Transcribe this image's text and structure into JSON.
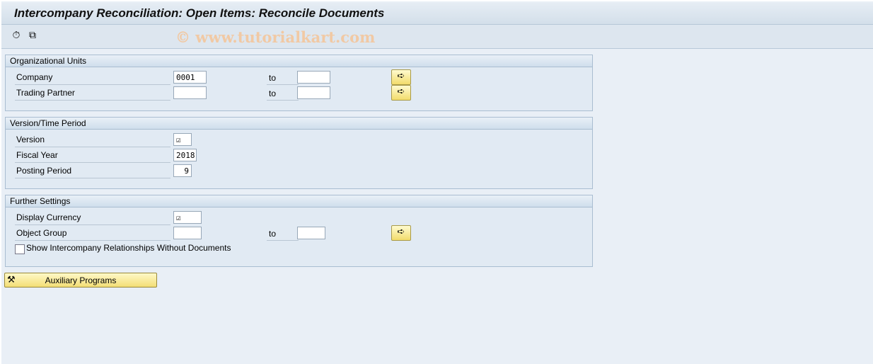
{
  "title": "Intercompany Reconciliation: Open Items: Reconcile Documents",
  "toolbar": {
    "icons": [
      "execute-background-icon",
      "get-variant-icon"
    ],
    "watermark": "© www.tutorialkart.com"
  },
  "org_units": {
    "header": "Organizational Units",
    "company": {
      "label": "Company",
      "from": "0001",
      "to_label": "to",
      "to": ""
    },
    "trading_partner": {
      "label": "Trading Partner",
      "from": "",
      "to_label": "to",
      "to": ""
    }
  },
  "version_period": {
    "header": "Version/Time Period",
    "version": {
      "label": "Version",
      "value": "☑"
    },
    "fiscal_year": {
      "label": "Fiscal Year",
      "value": "2018"
    },
    "posting_period": {
      "label": "Posting Period",
      "value": "9"
    }
  },
  "further": {
    "header": "Further Settings",
    "display_currency": {
      "label": "Display Currency",
      "value": "☑"
    },
    "object_group": {
      "label": "Object Group",
      "from": "",
      "to_label": "to",
      "to": ""
    },
    "show_relationships": {
      "label": "Show Intercompany Relationships Without Documents",
      "checked": false
    }
  },
  "aux_button": {
    "label": "Auxiliary Programs"
  },
  "colors": {
    "select_button": "#f2dc6c",
    "background": "#e9eff6"
  }
}
